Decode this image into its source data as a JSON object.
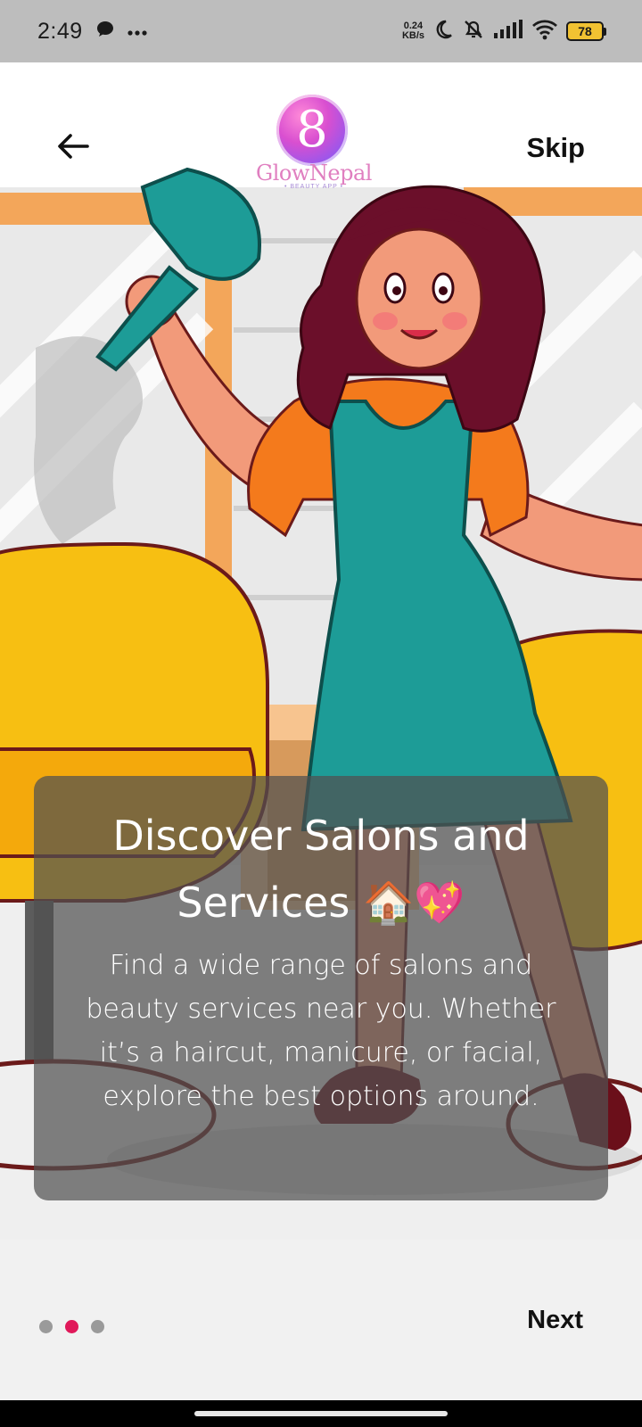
{
  "status_bar": {
    "time": "2:49",
    "net_speed_value": "0.24",
    "net_speed_unit": "KB/s",
    "battery": "78",
    "icons": [
      "chat-icon",
      "more-icon",
      "moon-icon",
      "mute-icon",
      "signal-icon",
      "wifi-icon",
      "battery-icon"
    ]
  },
  "header": {
    "back_icon": "arrow-left-icon",
    "skip_label": "Skip",
    "logo_mark": "8",
    "logo_text": "GlowNepal",
    "logo_subtext": "• BEAUTY APP •"
  },
  "slide": {
    "title": "Discover Salons and Services 🏠💖",
    "description": "Find a wide range of salons and beauty services near you. Whether it’s a haircut, manicure, or facial, explore the best options around."
  },
  "pager": {
    "total": 3,
    "active_index": 1
  },
  "footer": {
    "next_label": "Next"
  },
  "colors": {
    "accent_dot": "#e0195a",
    "inactive_dot": "#9a9a9a",
    "chair_yellow": "#f7bf12",
    "apron_teal": "#1d9c97",
    "shirt_orange": "#f47a1c"
  }
}
